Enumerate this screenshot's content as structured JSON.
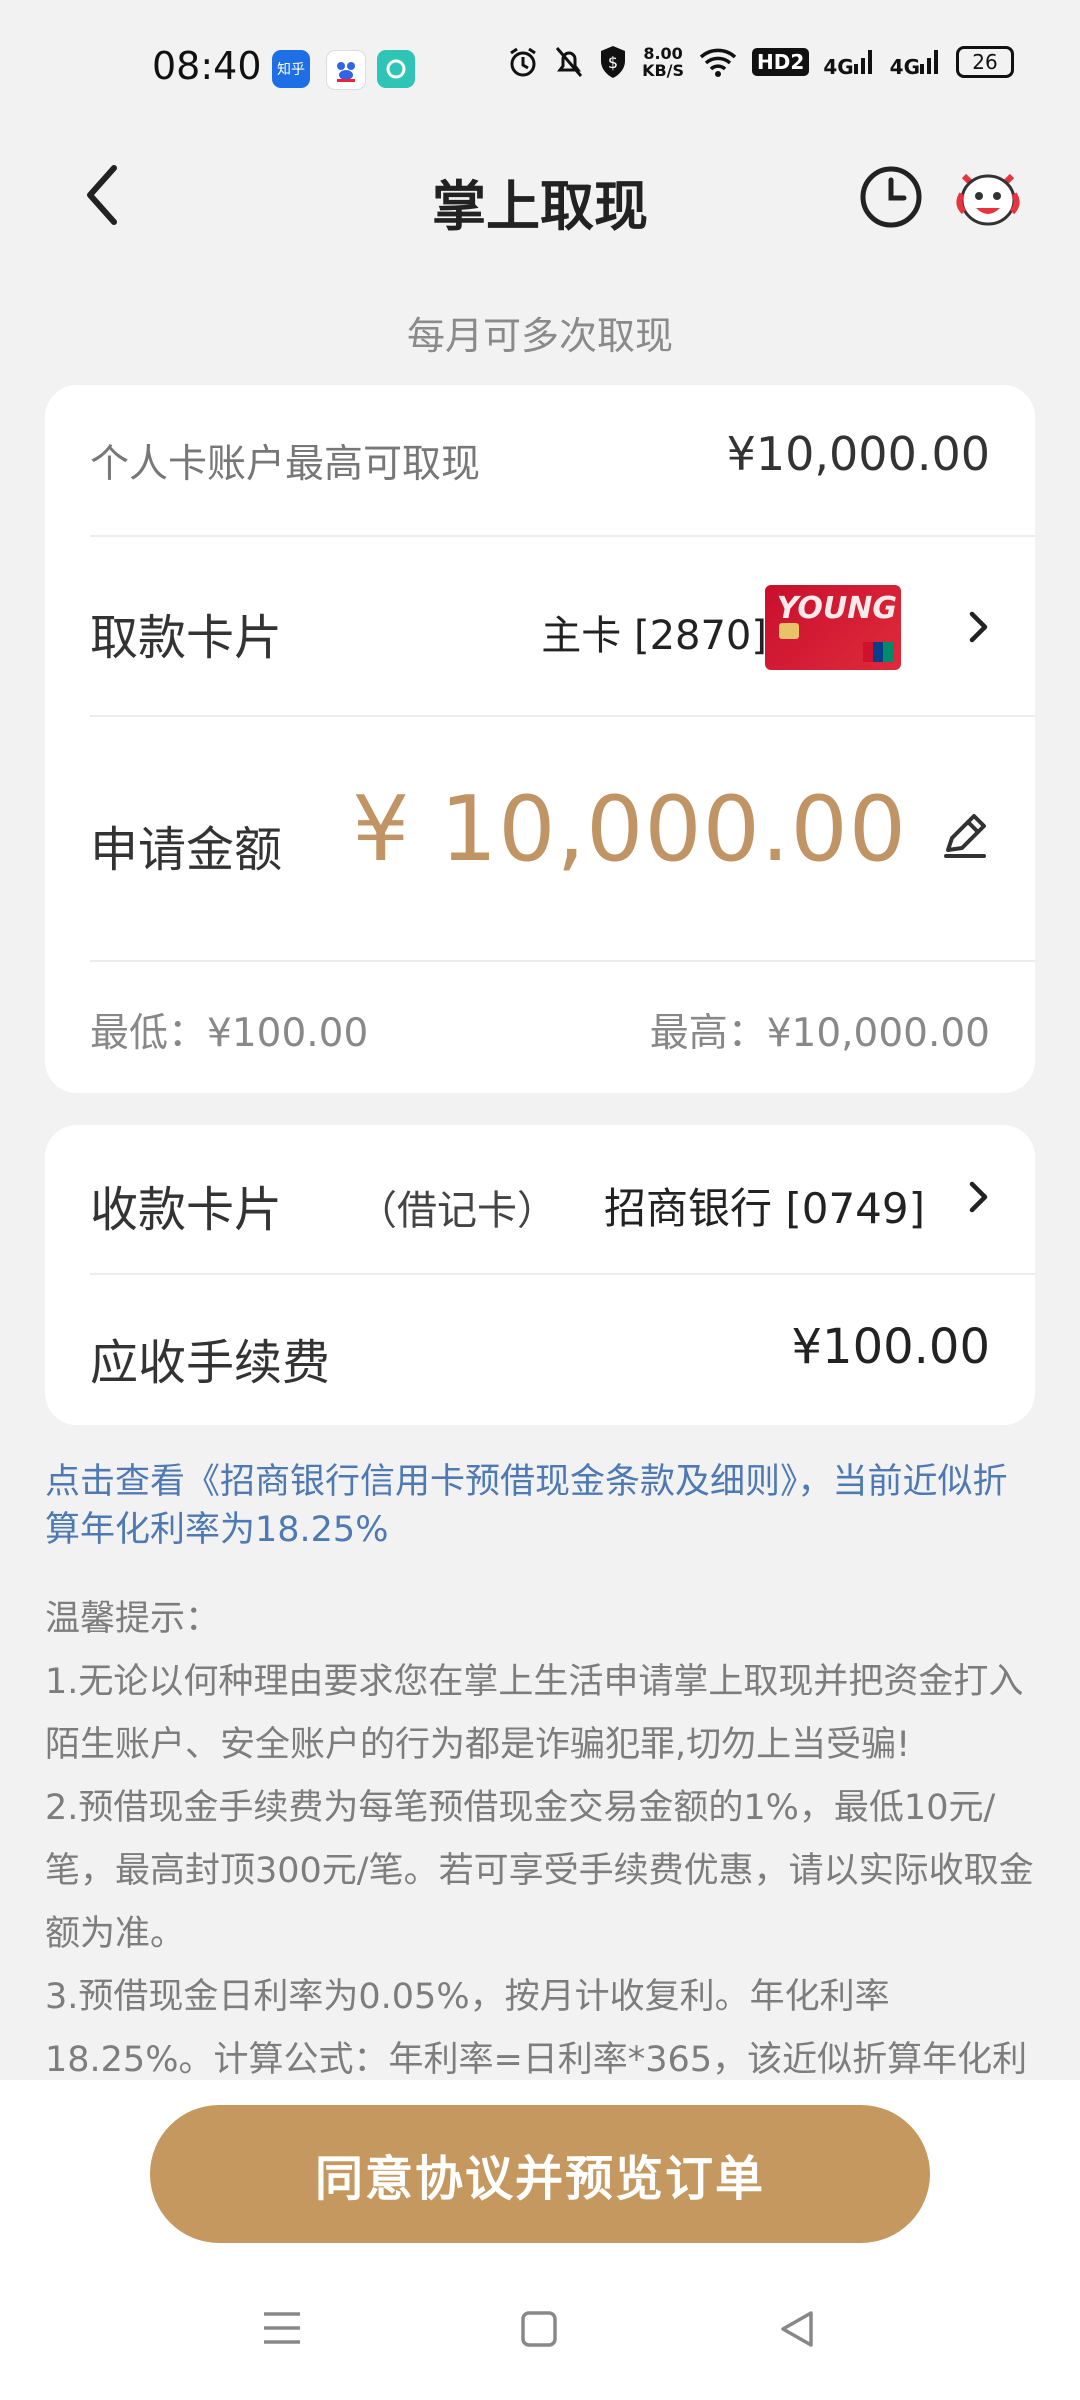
{
  "status_bar": {
    "time": "08:40",
    "app_icons": [
      "知乎",
      "百度",
      "app"
    ],
    "net_speed_top": "8.00",
    "net_speed_bottom": "KB/S",
    "hd_label": "HD2",
    "signal_1": "4G",
    "signal_2": "4G",
    "battery": "26"
  },
  "header": {
    "title": "掌上取现",
    "back_icon": "chevron-left-icon",
    "history_icon": "clock-icon",
    "mascot_icon": "mascot-avatar-icon"
  },
  "subtitle": "每月可多次取现",
  "withdraw_card": {
    "max_label": "个人卡账户最高可取现",
    "max_value": "¥10,000.00",
    "draw_card_label": "取款卡片",
    "draw_card_value": "主卡 [2870]",
    "card_image_text": "YOUNG",
    "apply_amount_label": "申请金额",
    "apply_amount_value": "¥ 10,000.00",
    "min_label": "最低：¥100.00",
    "max_range_label": "最高：¥10,000.00"
  },
  "receive_card": {
    "receive_label": "收款卡片",
    "receive_sublabel": "（借记卡）",
    "receive_value": "招商银行 [0749]",
    "fee_label": "应收手续费",
    "fee_value": "¥100.00"
  },
  "terms_link": "点击查看《招商银行信用卡预借现金条款及细则》，当前近似折算年化利率为18.25%",
  "tips": {
    "heading": "温馨提示：",
    "items": [
      "1.无论以何种理由要求您在掌上生活申请掌上取现并把资金打入陌生账户、安全账户的行为都是诈骗犯罪,切勿上当受骗!",
      "2.预借现金手续费为每笔预借现金交易金额的1%，最低10元/笔，最高封顶300元/笔。若可享受手续费优惠，请以实际收取金额为准。",
      "3.预借现金日利率为0.05%，按月计收复利。年化利率18.25%。计算公式：年利率=日利率*365，该近似折算年化利"
    ]
  },
  "cta_button": "同意协议并预览订单",
  "colors": {
    "accent": "#c4985f",
    "amount": "#c09464",
    "link": "#4e79b3",
    "background": "#f2f2f2"
  }
}
